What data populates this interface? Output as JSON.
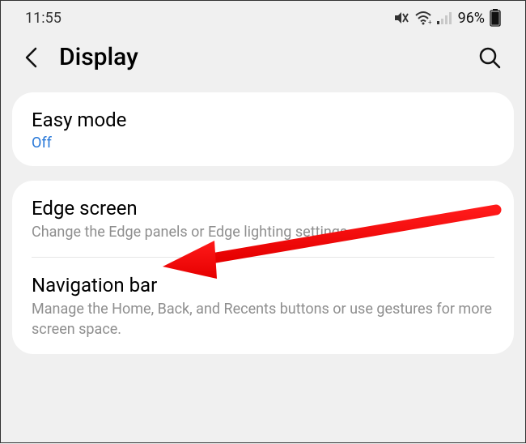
{
  "statusbar": {
    "time": "11:55",
    "battery_percent": "96%"
  },
  "header": {
    "title": "Display"
  },
  "card1": {
    "easymode": {
      "title": "Easy mode",
      "status": "Off"
    }
  },
  "card2": {
    "edgescreen": {
      "title": "Edge screen",
      "desc": "Change the Edge panels or Edge lighting settings."
    },
    "navbar": {
      "title": "Navigation bar",
      "desc": "Manage the Home, Back, and Recents buttons or use gestures for more screen space."
    }
  },
  "annotation": {
    "arrow_color": "#ff0000"
  }
}
